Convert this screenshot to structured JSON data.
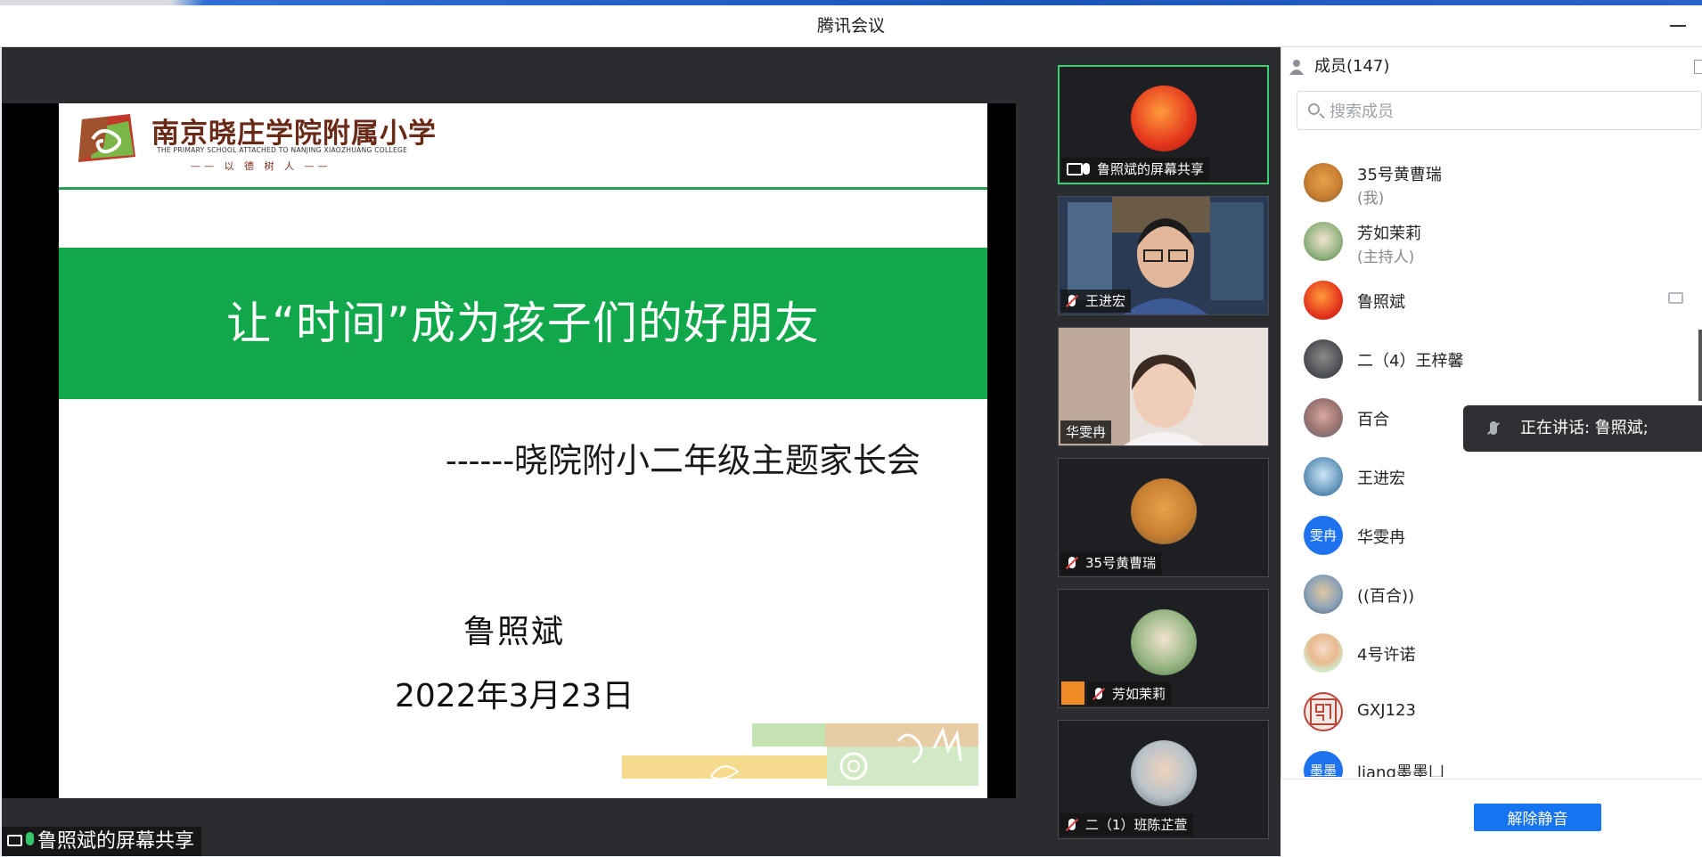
{
  "window": {
    "title": "腾讯会议"
  },
  "share": {
    "label": "鲁照斌的屏幕共享"
  },
  "slide": {
    "school_cn": "南京晓庄学院附属小学",
    "school_en": "THE PRIMARY SCHOOL ATTACHED TO NANJING XIAOZHUANG COLLEGE",
    "school_motto": "—— 以 德 树 人 ——",
    "title": "让“时间”成为孩子们的好朋友",
    "subtitle": "------晓院附小二年级主题家长会",
    "presenter": "鲁照斌",
    "date": "2022年3月23日"
  },
  "thumbnails": [
    {
      "name": "鲁照斌的屏幕共享",
      "muted": false
    },
    {
      "name": "王进宏",
      "muted": true
    },
    {
      "name": "华雯冉",
      "muted": false
    },
    {
      "name": "35号黄曹瑞",
      "muted": true
    },
    {
      "name": "芳如茉莉",
      "muted": true
    },
    {
      "name": "二（1）班陈芷萱",
      "muted": true
    }
  ],
  "panel": {
    "header": "成员(147)",
    "search_placeholder": "搜索成员",
    "members": [
      {
        "name": "35号黄曹瑞",
        "sub": "(我)"
      },
      {
        "name": "芳如茉莉",
        "sub": "(主持人)"
      },
      {
        "name": "鲁照斌",
        "sub": ""
      },
      {
        "name": "二（4）王梓馨",
        "sub": ""
      },
      {
        "name": "百合",
        "sub": ""
      },
      {
        "name": "王进宏",
        "sub": ""
      },
      {
        "name": "华雯冉",
        "sub": "",
        "avatar_text": "雯冉"
      },
      {
        "name": "((百合))",
        "sub": ""
      },
      {
        "name": "4号许诺",
        "sub": ""
      },
      {
        "name": "GXJ123",
        "sub": ""
      },
      {
        "name": "liang墨墨凵",
        "sub": "",
        "avatar_text": "墨墨"
      }
    ],
    "speaking": "正在讲话: 鲁照斌;",
    "unmute_all": "解除静音"
  },
  "colors": {
    "accent": "#1774f0",
    "banner_green": "#11a84b",
    "active_border": "#3bd16f"
  }
}
